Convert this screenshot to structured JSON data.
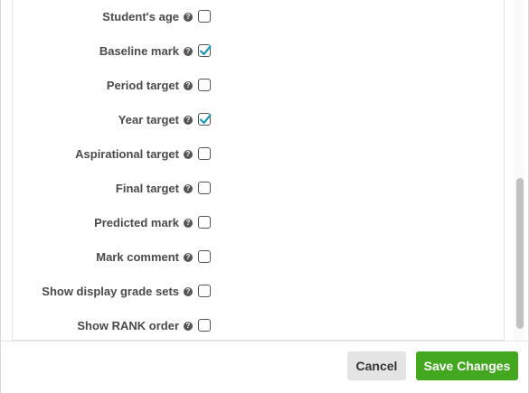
{
  "options": [
    {
      "label": "Student's age",
      "checked": false
    },
    {
      "label": "Baseline mark",
      "checked": true
    },
    {
      "label": "Period target",
      "checked": false
    },
    {
      "label": "Year target",
      "checked": true
    },
    {
      "label": "Aspirational target",
      "checked": false
    },
    {
      "label": "Final target",
      "checked": false
    },
    {
      "label": "Predicted mark",
      "checked": false
    },
    {
      "label": "Mark comment",
      "checked": false
    },
    {
      "label": "Show display grade sets",
      "checked": false
    },
    {
      "label": "Show RANK order",
      "checked": false
    }
  ],
  "help_glyph": "?",
  "footer": {
    "cancel_label": "Cancel",
    "save_label": "Save Changes"
  },
  "colors": {
    "check_accent": "#1a9bbd",
    "save_button": "#43a820"
  }
}
